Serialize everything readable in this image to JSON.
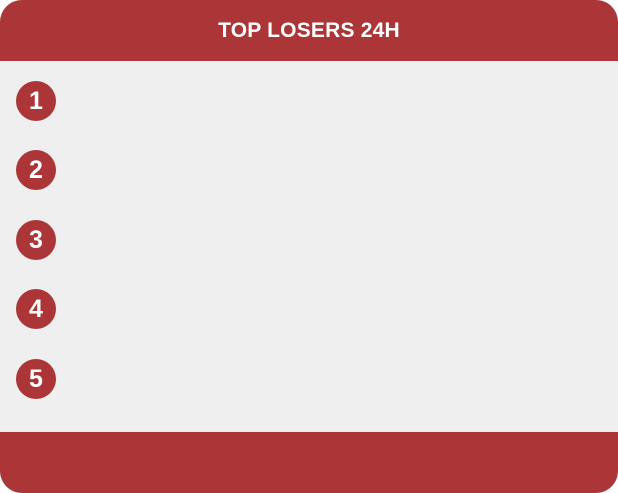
{
  "header": {
    "title": "TOP LOSERS 24H"
  },
  "list": {
    "items": [
      {
        "rank": "1"
      },
      {
        "rank": "2"
      },
      {
        "rank": "3"
      },
      {
        "rank": "4"
      },
      {
        "rank": "5"
      }
    ]
  },
  "colors": {
    "accent": "#ab3537",
    "panel_background": "#efefef",
    "text_on_accent": "#ffffff"
  }
}
